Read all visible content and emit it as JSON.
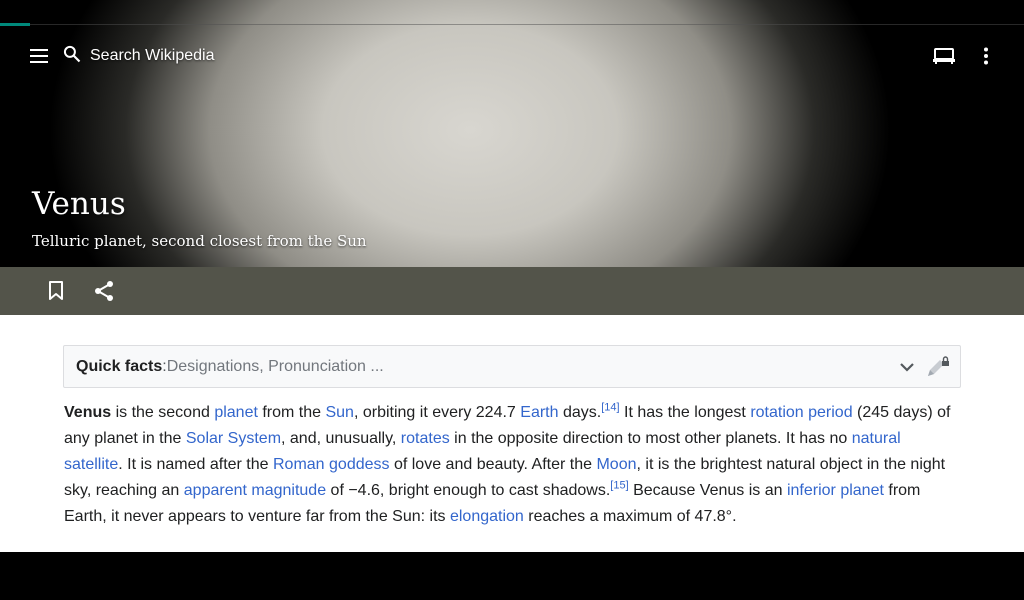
{
  "colors": {
    "accent": "#00897b",
    "link": "#3366cc",
    "action_bar": "#53544a",
    "text": "#202122"
  },
  "toolbar": {
    "menu_icon": "hamburger-menu-icon",
    "search_icon": "search-icon",
    "search_placeholder": "Search Wikipedia",
    "reading_list_icon": "reading-lists-icon",
    "overflow_icon": "more-vert-icon"
  },
  "article": {
    "title": "Venus",
    "description": "Telluric planet, second closest from the Sun"
  },
  "actions": {
    "bookmark_icon": "bookmark-icon",
    "share_icon": "share-icon"
  },
  "quick_facts": {
    "label": "Quick facts",
    "separator": ":",
    "items": " Designations, Pronunciation ..."
  },
  "paragraph": {
    "s1": "Venus",
    "s2": " is the second ",
    "l_planet": "planet",
    "s3": " from the ",
    "l_sun": "Sun",
    "s4": ", orbiting it every 224.7 ",
    "l_earth": "Earth",
    "s5": " days.",
    "ref14": "[14]",
    "s6": " It has the longest ",
    "l_rotation": "rotation period",
    "s7": " (245 days) of any planet in the ",
    "l_solar": "Solar System",
    "s8": ", and, unusually, ",
    "l_rotates": "rotates",
    "s9": " in the opposite direction to most other planets. It has no ",
    "l_natural": "natural satellite",
    "s10": ". It is named after the ",
    "l_roman": "Roman goddess",
    "s11": " of love and beauty. After the ",
    "l_moon": "Moon",
    "s12": ", it is the brightest natural object in the night sky, reaching an ",
    "l_apparent": "apparent magnitude",
    "s13": " of −4.6, bright enough to cast shadows.",
    "ref15": "[15]",
    "s14": " Because Venus is an ",
    "l_inferior": "inferior planet",
    "s15": " from Earth, it never appears to venture far from the Sun: its ",
    "l_elongation": "elongation",
    "s16": " reaches a maximum of 47.8°."
  }
}
